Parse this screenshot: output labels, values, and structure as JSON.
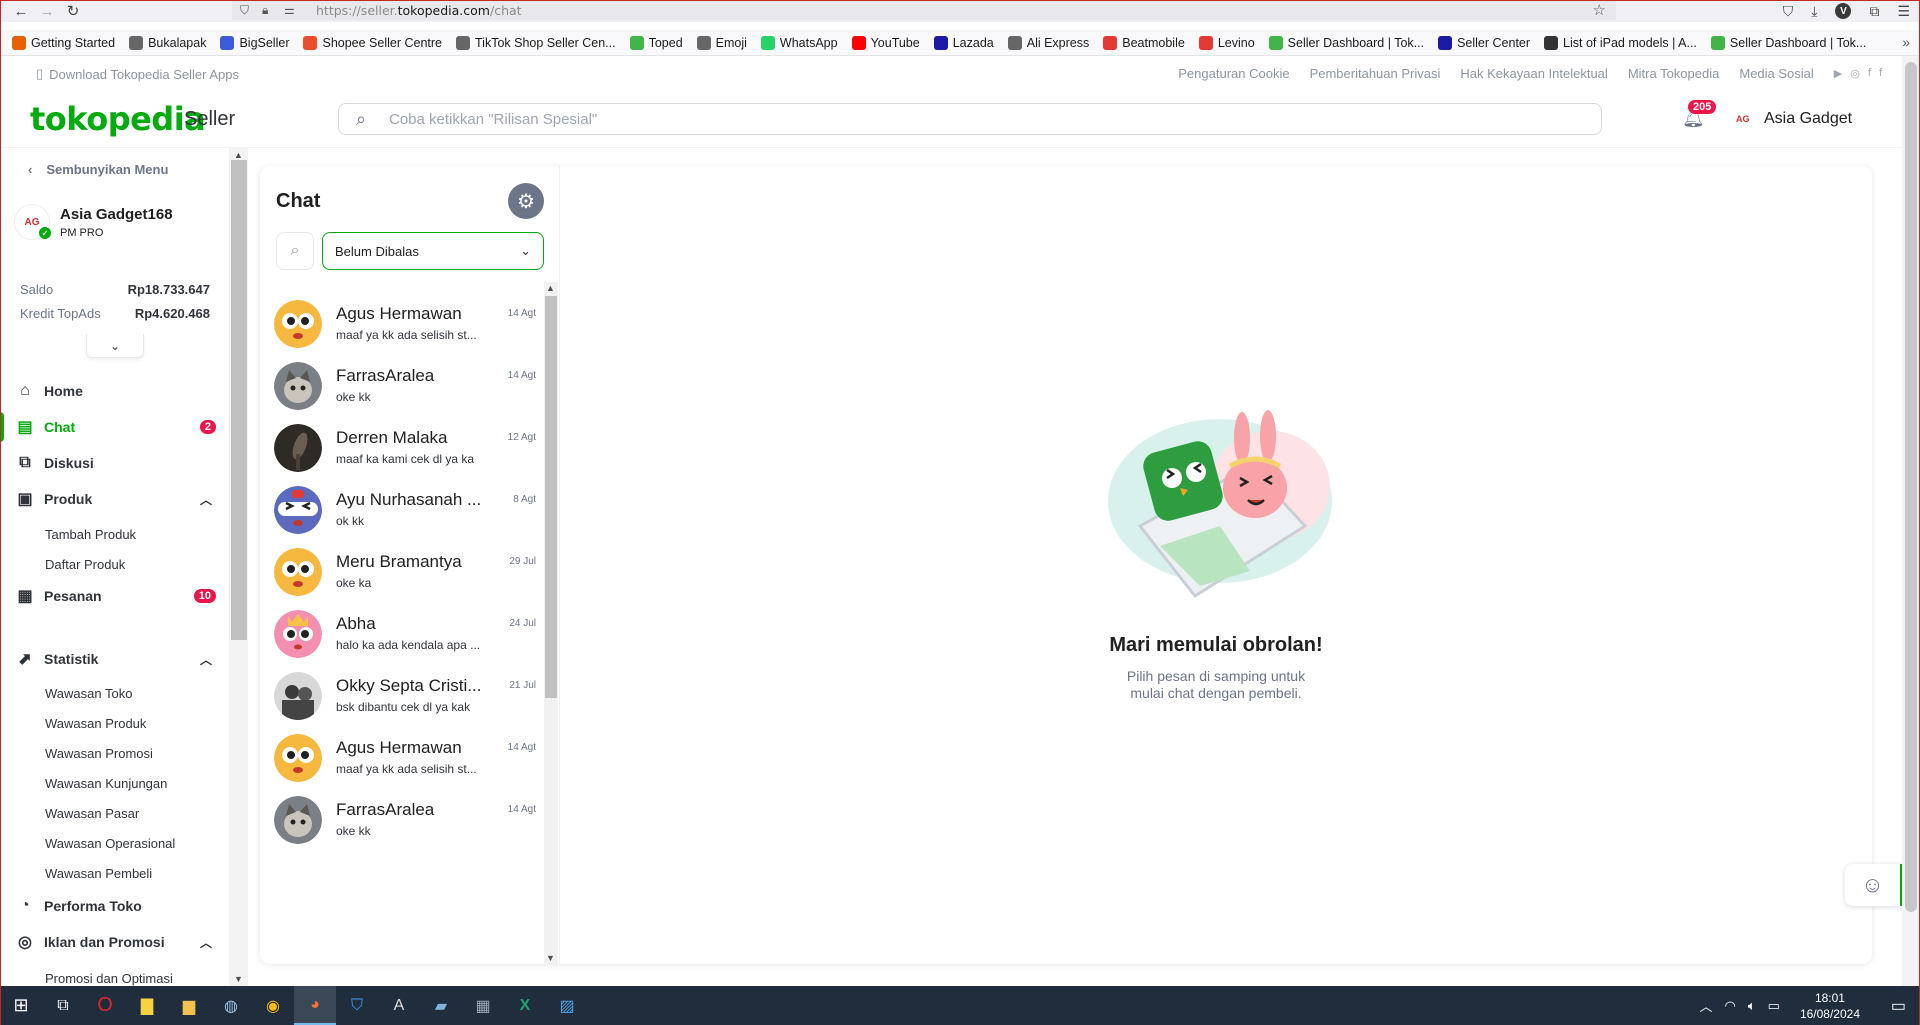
{
  "browser": {
    "url_prefix": "https://seller.",
    "url_domain": "tokopedia.com",
    "url_path": "/chat",
    "profile_initial": "V",
    "bookmarks": [
      {
        "label": "Getting Started",
        "color": "#e66000"
      },
      {
        "label": "Bukalapak",
        "color": "#666666"
      },
      {
        "label": "BigSeller",
        "color": "#3b5bdb"
      },
      {
        "label": "Shopee Seller Centre",
        "color": "#ee4d2d"
      },
      {
        "label": "TikTok Shop Seller Cen...",
        "color": "#666666"
      },
      {
        "label": "Toped",
        "color": "#42b549"
      },
      {
        "label": "Emoji",
        "color": "#666666"
      },
      {
        "label": "WhatsApp",
        "color": "#25d366"
      },
      {
        "label": "YouTube",
        "color": "#ff0000"
      },
      {
        "label": "Lazada",
        "color": "#1a1aa6"
      },
      {
        "label": "Ali Express",
        "color": "#666666"
      },
      {
        "label": "Beatmobile",
        "color": "#e53935"
      },
      {
        "label": "Levino",
        "color": "#e53935"
      },
      {
        "label": "Seller Dashboard | Tok...",
        "color": "#42b549"
      },
      {
        "label": "Seller Center",
        "color": "#1a1aa6"
      },
      {
        "label": "List of iPad models | A...",
        "color": "#333333"
      },
      {
        "label": "Seller Dashboard | Tok...",
        "color": "#42b549"
      }
    ]
  },
  "topstrip": {
    "download": "Download Tokopedia Seller Apps",
    "links": [
      "Pengaturan Cookie",
      "Pemberitahuan Privasi",
      "Hak Kekayaan Intelektual",
      "Mitra Tokopedia",
      "Media Sosial"
    ]
  },
  "header": {
    "logo": "tokopedia",
    "logo_suffix": "Seller",
    "search_placeholder": "Coba ketikkan \"Rilisan Spesial\"",
    "notif_count": "205",
    "shop_name": "Asia Gadget"
  },
  "sidebar": {
    "hide_menu": "Sembunyikan Menu",
    "shop_name": "Asia Gadget168",
    "shop_tier": "PM PRO",
    "saldo_label": "Saldo",
    "saldo_value": "Rp18.733.647",
    "topads_label": "Kredit TopAds",
    "topads_value": "Rp4.620.468",
    "menu": {
      "home": "Home",
      "chat": "Chat",
      "chat_badge": "2",
      "diskusi": "Diskusi",
      "produk": "Produk",
      "tambah_produk": "Tambah Produk",
      "daftar_produk": "Daftar Produk",
      "pesanan": "Pesanan",
      "pesanan_badge": "10",
      "statistik": "Statistik",
      "wawasan_toko": "Wawasan Toko",
      "wawasan_produk": "Wawasan Produk",
      "wawasan_promosi": "Wawasan Promosi",
      "wawasan_kunjungan": "Wawasan Kunjungan",
      "wawasan_pasar": "Wawasan Pasar",
      "wawasan_operasional": "Wawasan Operasional",
      "wawasan_pembeli": "Wawasan Pembeli",
      "performa_toko": "Performa Toko",
      "iklan_promosi": "Iklan dan Promosi",
      "promosi_optimasi": "Promosi dan Optimasi"
    }
  },
  "chat": {
    "title": "Chat",
    "filter_value": "Belum Dibalas",
    "conversations": [
      {
        "name": "Agus Hermawan",
        "message": "maaf ya kk ada selisih st...",
        "date": "14 Agt",
        "avatar": "owl-yellow"
      },
      {
        "name": "FarrasAralea",
        "message": "oke kk",
        "date": "14 Agt",
        "avatar": "cat-photo"
      },
      {
        "name": "Derren Malaka",
        "message": "maaf ka kami cek dl ya ka",
        "date": "12 Agt",
        "avatar": "dark-photo"
      },
      {
        "name": "Ayu Nurhasanah ...",
        "message": "ok kk",
        "date": "8 Agt",
        "avatar": "owl-helmet"
      },
      {
        "name": "Meru Bramantya",
        "message": "oke ka",
        "date": "29 Jul",
        "avatar": "owl-yellow"
      },
      {
        "name": "Abha",
        "message": "halo ka ada kendala apa ...",
        "date": "24 Jul",
        "avatar": "owl-pink"
      },
      {
        "name": "Okky Septa Cristi...",
        "message": "bsk dibantu cek dl ya kak",
        "date": "21 Jul",
        "avatar": "bw-photo"
      },
      {
        "name": "Agus Hermawan",
        "message": "maaf ya kk ada selisih st...",
        "date": "14 Agt",
        "avatar": "owl-yellow"
      },
      {
        "name": "FarrasAralea",
        "message": "oke kk",
        "date": "14 Agt",
        "avatar": "cat-photo"
      }
    ],
    "empty_title": "Mari memulai obrolan!",
    "empty_sub_1": "Pilih pesan di samping untuk",
    "empty_sub_2": "mulai chat dengan pembeli."
  },
  "taskbar": {
    "time": "18:01",
    "date": "16/08/2024"
  },
  "colors": {
    "brand_green": "#03ac0e",
    "badge_red": "#ef144a",
    "taskbar": "#1f2d3d"
  }
}
